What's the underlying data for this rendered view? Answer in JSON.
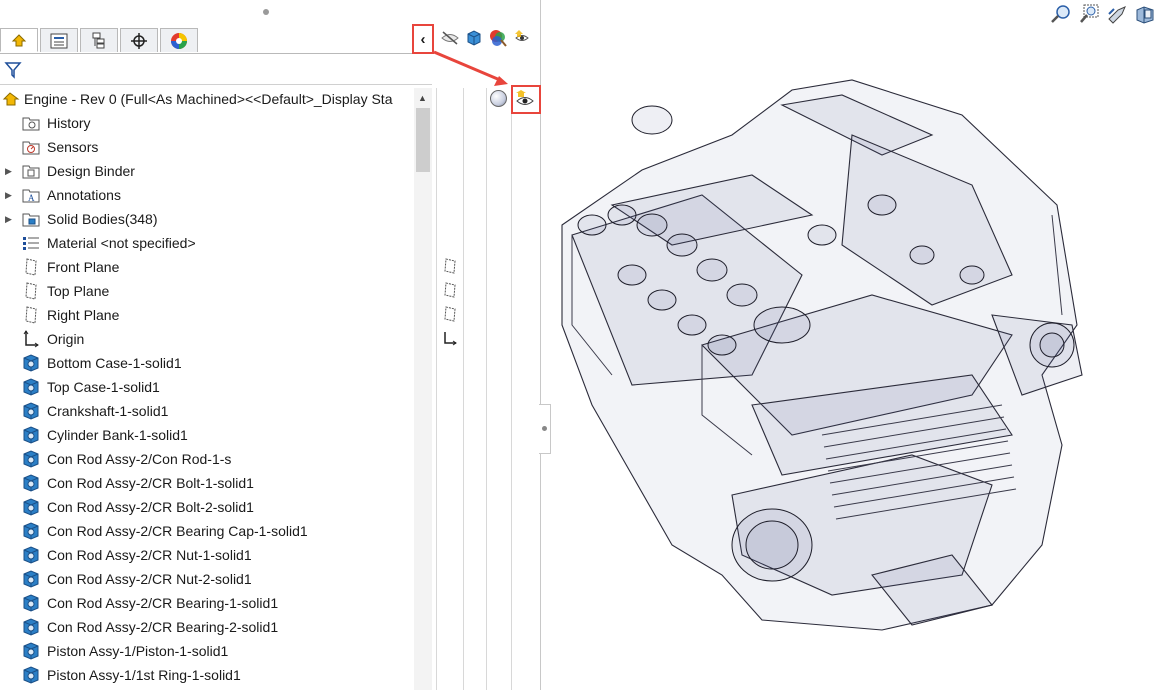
{
  "feature_tree": {
    "root": {
      "label": "Engine - Rev 0  (Full<As Machined><<Default>_Display Sta"
    },
    "items": [
      {
        "label": "History",
        "icon": "history-folder-icon",
        "expandable": false
      },
      {
        "label": "Sensors",
        "icon": "sensors-icon",
        "expandable": false
      },
      {
        "label": "Design Binder",
        "icon": "design-binder-icon",
        "expandable": true
      },
      {
        "label": "Annotations",
        "icon": "annotations-icon",
        "expandable": true
      },
      {
        "label": "Solid Bodies(348)",
        "icon": "solid-bodies-icon",
        "expandable": true
      },
      {
        "label": "Material <not specified>",
        "icon": "material-icon",
        "expandable": false
      },
      {
        "label": "Front Plane",
        "icon": "plane-icon",
        "expandable": false
      },
      {
        "label": "Top Plane",
        "icon": "plane-icon",
        "expandable": false
      },
      {
        "label": "Right Plane",
        "icon": "plane-icon",
        "expandable": false
      },
      {
        "label": "Origin",
        "icon": "origin-icon",
        "expandable": false
      },
      {
        "label": "Bottom Case-1-solid1",
        "icon": "solid-body-icon",
        "expandable": false
      },
      {
        "label": "Top Case-1-solid1",
        "icon": "solid-body-icon",
        "expandable": false
      },
      {
        "label": "Crankshaft-1-solid1",
        "icon": "solid-body-icon",
        "expandable": false
      },
      {
        "label": "Cylinder Bank-1-solid1",
        "icon": "solid-body-icon",
        "expandable": false
      },
      {
        "label": "Con Rod Assy-2/Con Rod-1-s",
        "icon": "solid-body-icon",
        "expandable": false
      },
      {
        "label": "Con Rod Assy-2/CR Bolt-1-solid1",
        "icon": "solid-body-icon",
        "expandable": false
      },
      {
        "label": "Con Rod Assy-2/CR Bolt-2-solid1",
        "icon": "solid-body-icon",
        "expandable": false
      },
      {
        "label": "Con Rod Assy-2/CR Bearing Cap-1-solid1",
        "icon": "solid-body-icon",
        "expandable": false
      },
      {
        "label": "Con Rod Assy-2/CR Nut-1-solid1",
        "icon": "solid-body-icon",
        "expandable": false
      },
      {
        "label": "Con Rod Assy-2/CR Nut-2-solid1",
        "icon": "solid-body-icon",
        "expandable": false
      },
      {
        "label": "Con Rod Assy-2/CR Bearing-1-solid1",
        "icon": "solid-body-icon",
        "expandable": false
      },
      {
        "label": "Con Rod Assy-2/CR Bearing-2-solid1",
        "icon": "solid-body-icon",
        "expandable": false
      },
      {
        "label": "Piston Assy-1/Piston-1-solid1",
        "icon": "solid-body-icon",
        "expandable": false
      },
      {
        "label": "Piston Assy-1/1st Ring-1-solid1",
        "icon": "solid-body-icon",
        "expandable": false
      }
    ]
  },
  "tabs": [
    {
      "name": "featuremanager-tab",
      "active": true
    },
    {
      "name": "propertymanager-tab",
      "active": false
    },
    {
      "name": "configurationmanager-tab",
      "active": false
    },
    {
      "name": "dimxpertmanager-tab",
      "active": false
    },
    {
      "name": "displaymanager-tab",
      "active": false
    }
  ],
  "display_pane": {
    "collapse_glyph": "‹",
    "header_icons": [
      "hide-show-icon",
      "display-mode-icon",
      "appearance-icon",
      "transparency-icon"
    ]
  },
  "view_tools": [
    "zoom-to-fit-icon",
    "zoom-to-area-icon",
    "previous-view-icon",
    "section-view-icon"
  ],
  "colors": {
    "highlight": "#e8453c",
    "solid_blue": "#2b7fc6",
    "model_tint": "#5a6294"
  }
}
